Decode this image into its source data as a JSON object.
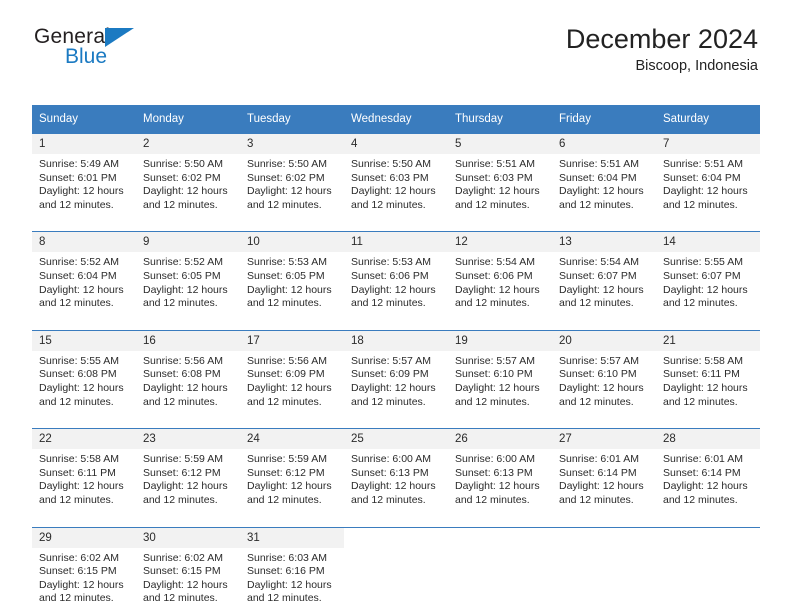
{
  "logo": {
    "line1": "General",
    "line2": "Blue",
    "triangle_icon": "blue-triangle-icon",
    "brand_color": "#1b7ac2"
  },
  "header": {
    "title": "December 2024",
    "subtitle": "Biscoop, Indonesia"
  },
  "theme": {
    "header_bg": "#3a7cbe",
    "header_text": "#ffffff",
    "daynum_bg": "#f2f2f2",
    "row_divider": "#3a7cbe"
  },
  "weekday_headers": [
    "Sunday",
    "Monday",
    "Tuesday",
    "Wednesday",
    "Thursday",
    "Friday",
    "Saturday"
  ],
  "weeks": [
    [
      {
        "day": "1",
        "sunrise": "Sunrise: 5:49 AM",
        "sunset": "Sunset: 6:01 PM",
        "daylight1": "Daylight: 12 hours",
        "daylight2": "and 12 minutes."
      },
      {
        "day": "2",
        "sunrise": "Sunrise: 5:50 AM",
        "sunset": "Sunset: 6:02 PM",
        "daylight1": "Daylight: 12 hours",
        "daylight2": "and 12 minutes."
      },
      {
        "day": "3",
        "sunrise": "Sunrise: 5:50 AM",
        "sunset": "Sunset: 6:02 PM",
        "daylight1": "Daylight: 12 hours",
        "daylight2": "and 12 minutes."
      },
      {
        "day": "4",
        "sunrise": "Sunrise: 5:50 AM",
        "sunset": "Sunset: 6:03 PM",
        "daylight1": "Daylight: 12 hours",
        "daylight2": "and 12 minutes."
      },
      {
        "day": "5",
        "sunrise": "Sunrise: 5:51 AM",
        "sunset": "Sunset: 6:03 PM",
        "daylight1": "Daylight: 12 hours",
        "daylight2": "and 12 minutes."
      },
      {
        "day": "6",
        "sunrise": "Sunrise: 5:51 AM",
        "sunset": "Sunset: 6:04 PM",
        "daylight1": "Daylight: 12 hours",
        "daylight2": "and 12 minutes."
      },
      {
        "day": "7",
        "sunrise": "Sunrise: 5:51 AM",
        "sunset": "Sunset: 6:04 PM",
        "daylight1": "Daylight: 12 hours",
        "daylight2": "and 12 minutes."
      }
    ],
    [
      {
        "day": "8",
        "sunrise": "Sunrise: 5:52 AM",
        "sunset": "Sunset: 6:04 PM",
        "daylight1": "Daylight: 12 hours",
        "daylight2": "and 12 minutes."
      },
      {
        "day": "9",
        "sunrise": "Sunrise: 5:52 AM",
        "sunset": "Sunset: 6:05 PM",
        "daylight1": "Daylight: 12 hours",
        "daylight2": "and 12 minutes."
      },
      {
        "day": "10",
        "sunrise": "Sunrise: 5:53 AM",
        "sunset": "Sunset: 6:05 PM",
        "daylight1": "Daylight: 12 hours",
        "daylight2": "and 12 minutes."
      },
      {
        "day": "11",
        "sunrise": "Sunrise: 5:53 AM",
        "sunset": "Sunset: 6:06 PM",
        "daylight1": "Daylight: 12 hours",
        "daylight2": "and 12 minutes."
      },
      {
        "day": "12",
        "sunrise": "Sunrise: 5:54 AM",
        "sunset": "Sunset: 6:06 PM",
        "daylight1": "Daylight: 12 hours",
        "daylight2": "and 12 minutes."
      },
      {
        "day": "13",
        "sunrise": "Sunrise: 5:54 AM",
        "sunset": "Sunset: 6:07 PM",
        "daylight1": "Daylight: 12 hours",
        "daylight2": "and 12 minutes."
      },
      {
        "day": "14",
        "sunrise": "Sunrise: 5:55 AM",
        "sunset": "Sunset: 6:07 PM",
        "daylight1": "Daylight: 12 hours",
        "daylight2": "and 12 minutes."
      }
    ],
    [
      {
        "day": "15",
        "sunrise": "Sunrise: 5:55 AM",
        "sunset": "Sunset: 6:08 PM",
        "daylight1": "Daylight: 12 hours",
        "daylight2": "and 12 minutes."
      },
      {
        "day": "16",
        "sunrise": "Sunrise: 5:56 AM",
        "sunset": "Sunset: 6:08 PM",
        "daylight1": "Daylight: 12 hours",
        "daylight2": "and 12 minutes."
      },
      {
        "day": "17",
        "sunrise": "Sunrise: 5:56 AM",
        "sunset": "Sunset: 6:09 PM",
        "daylight1": "Daylight: 12 hours",
        "daylight2": "and 12 minutes."
      },
      {
        "day": "18",
        "sunrise": "Sunrise: 5:57 AM",
        "sunset": "Sunset: 6:09 PM",
        "daylight1": "Daylight: 12 hours",
        "daylight2": "and 12 minutes."
      },
      {
        "day": "19",
        "sunrise": "Sunrise: 5:57 AM",
        "sunset": "Sunset: 6:10 PM",
        "daylight1": "Daylight: 12 hours",
        "daylight2": "and 12 minutes."
      },
      {
        "day": "20",
        "sunrise": "Sunrise: 5:57 AM",
        "sunset": "Sunset: 6:10 PM",
        "daylight1": "Daylight: 12 hours",
        "daylight2": "and 12 minutes."
      },
      {
        "day": "21",
        "sunrise": "Sunrise: 5:58 AM",
        "sunset": "Sunset: 6:11 PM",
        "daylight1": "Daylight: 12 hours",
        "daylight2": "and 12 minutes."
      }
    ],
    [
      {
        "day": "22",
        "sunrise": "Sunrise: 5:58 AM",
        "sunset": "Sunset: 6:11 PM",
        "daylight1": "Daylight: 12 hours",
        "daylight2": "and 12 minutes."
      },
      {
        "day": "23",
        "sunrise": "Sunrise: 5:59 AM",
        "sunset": "Sunset: 6:12 PM",
        "daylight1": "Daylight: 12 hours",
        "daylight2": "and 12 minutes."
      },
      {
        "day": "24",
        "sunrise": "Sunrise: 5:59 AM",
        "sunset": "Sunset: 6:12 PM",
        "daylight1": "Daylight: 12 hours",
        "daylight2": "and 12 minutes."
      },
      {
        "day": "25",
        "sunrise": "Sunrise: 6:00 AM",
        "sunset": "Sunset: 6:13 PM",
        "daylight1": "Daylight: 12 hours",
        "daylight2": "and 12 minutes."
      },
      {
        "day": "26",
        "sunrise": "Sunrise: 6:00 AM",
        "sunset": "Sunset: 6:13 PM",
        "daylight1": "Daylight: 12 hours",
        "daylight2": "and 12 minutes."
      },
      {
        "day": "27",
        "sunrise": "Sunrise: 6:01 AM",
        "sunset": "Sunset: 6:14 PM",
        "daylight1": "Daylight: 12 hours",
        "daylight2": "and 12 minutes."
      },
      {
        "day": "28",
        "sunrise": "Sunrise: 6:01 AM",
        "sunset": "Sunset: 6:14 PM",
        "daylight1": "Daylight: 12 hours",
        "daylight2": "and 12 minutes."
      }
    ],
    [
      {
        "day": "29",
        "sunrise": "Sunrise: 6:02 AM",
        "sunset": "Sunset: 6:15 PM",
        "daylight1": "Daylight: 12 hours",
        "daylight2": "and 12 minutes."
      },
      {
        "day": "30",
        "sunrise": "Sunrise: 6:02 AM",
        "sunset": "Sunset: 6:15 PM",
        "daylight1": "Daylight: 12 hours",
        "daylight2": "and 12 minutes."
      },
      {
        "day": "31",
        "sunrise": "Sunrise: 6:03 AM",
        "sunset": "Sunset: 6:16 PM",
        "daylight1": "Daylight: 12 hours",
        "daylight2": "and 12 minutes."
      },
      {
        "day": "",
        "sunrise": "",
        "sunset": "",
        "daylight1": "",
        "daylight2": ""
      },
      {
        "day": "",
        "sunrise": "",
        "sunset": "",
        "daylight1": "",
        "daylight2": ""
      },
      {
        "day": "",
        "sunrise": "",
        "sunset": "",
        "daylight1": "",
        "daylight2": ""
      },
      {
        "day": "",
        "sunrise": "",
        "sunset": "",
        "daylight1": "",
        "daylight2": ""
      }
    ]
  ]
}
